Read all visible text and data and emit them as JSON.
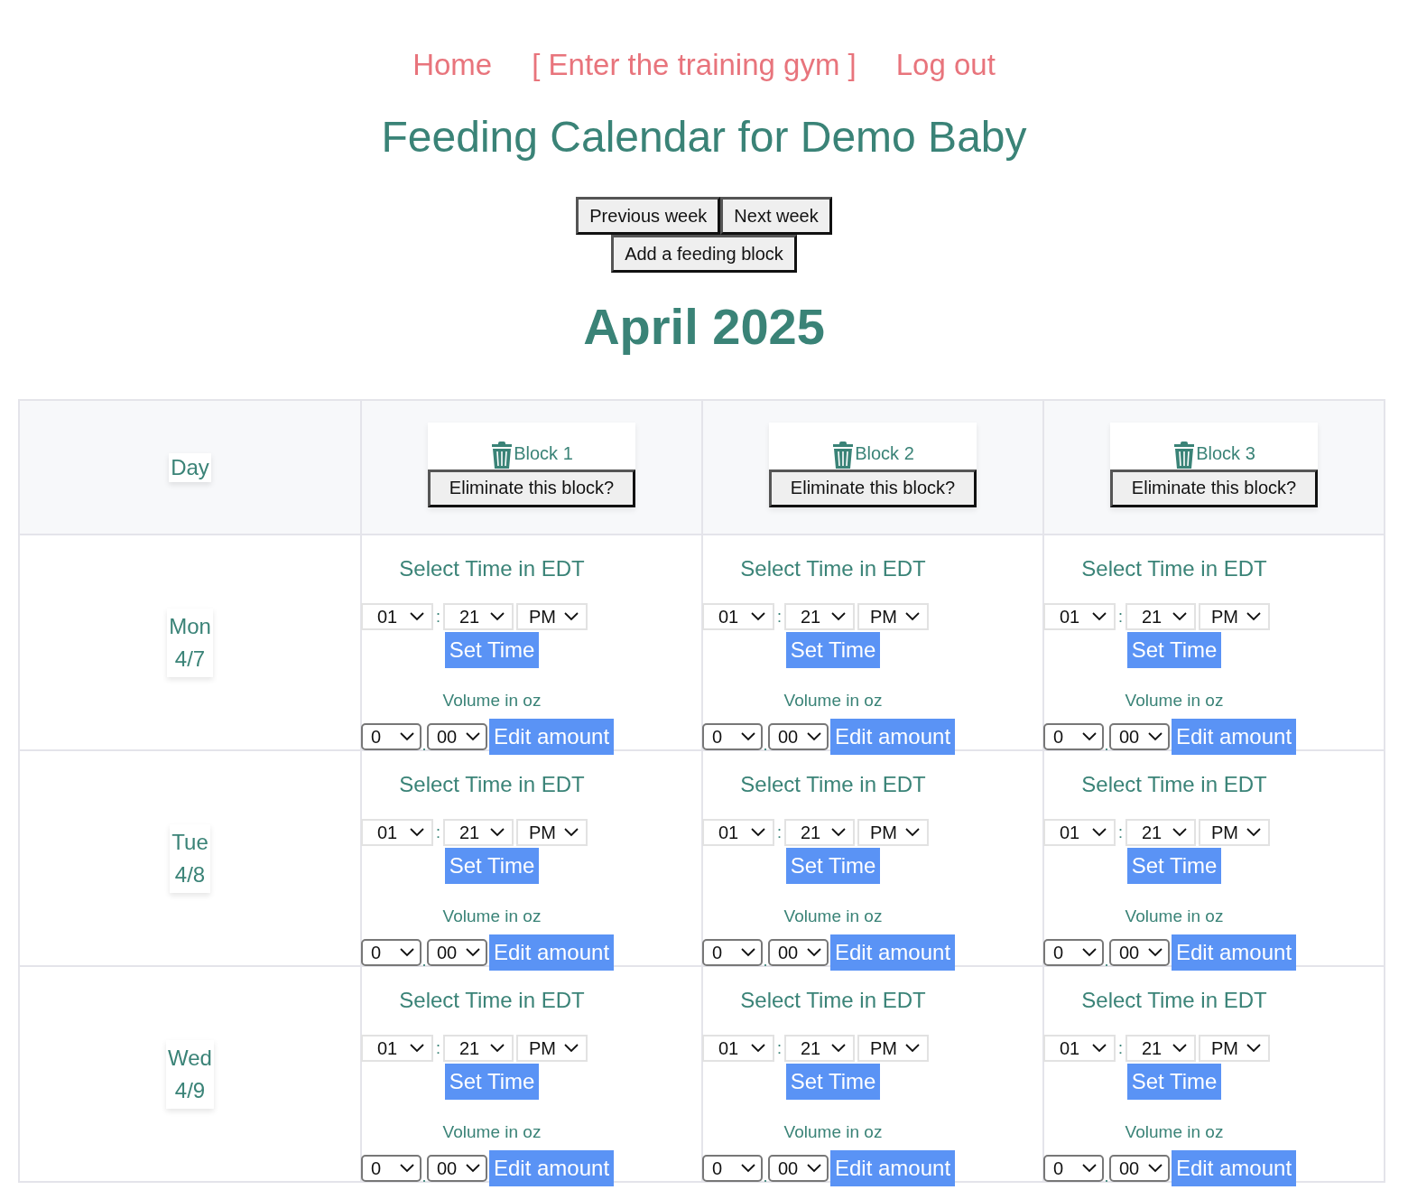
{
  "nav": [
    {
      "label": "Home"
    },
    {
      "label": "[ Enter the training gym ]"
    },
    {
      "label": "Log out"
    }
  ],
  "title": "Feeding Calendar for Demo Baby",
  "week_buttons": [
    "Previous week",
    "Next week"
  ],
  "add_button": "Add a feeding block",
  "month": "April 2025",
  "table": {
    "day_header": "Day",
    "blocks": [
      {
        "label": "Block 1",
        "button": "Eliminate this block?"
      },
      {
        "label": "Block 2",
        "button": "Eliminate this block?"
      },
      {
        "label": "Block 3",
        "button": "Eliminate this block?"
      }
    ],
    "rows": [
      {
        "day": "Mon",
        "date": "4/7",
        "cells": [
          {
            "time_label": "Select Time in EDT",
            "hour": "01",
            "time_separator": ":",
            "minute": "21",
            "meridiem": "PM",
            "set_button": "Set Time",
            "volume_label": "Volume in oz",
            "oz_whole": "0",
            "volume_separator": ".",
            "oz_fraction": "00",
            "edit_button": "Edit amount"
          },
          {
            "time_label": "Select Time in EDT",
            "hour": "01",
            "time_separator": ":",
            "minute": "21",
            "meridiem": "PM",
            "set_button": "Set Time",
            "volume_label": "Volume in oz",
            "oz_whole": "0",
            "volume_separator": ".",
            "oz_fraction": "00",
            "edit_button": "Edit amount"
          },
          {
            "time_label": "Select Time in EDT",
            "hour": "01",
            "time_separator": ":",
            "minute": "21",
            "meridiem": "PM",
            "set_button": "Set Time",
            "volume_label": "Volume in oz",
            "oz_whole": "0",
            "volume_separator": ".",
            "oz_fraction": "00",
            "edit_button": "Edit amount"
          }
        ]
      },
      {
        "day": "Tue",
        "date": "4/8",
        "cells": [
          {
            "time_label": "Select Time in EDT",
            "hour": "01",
            "time_separator": ":",
            "minute": "21",
            "meridiem": "PM",
            "set_button": "Set Time",
            "volume_label": "Volume in oz",
            "oz_whole": "0",
            "volume_separator": ".",
            "oz_fraction": "00",
            "edit_button": "Edit amount"
          },
          {
            "time_label": "Select Time in EDT",
            "hour": "01",
            "time_separator": ":",
            "minute": "21",
            "meridiem": "PM",
            "set_button": "Set Time",
            "volume_label": "Volume in oz",
            "oz_whole": "0",
            "volume_separator": ".",
            "oz_fraction": "00",
            "edit_button": "Edit amount"
          },
          {
            "time_label": "Select Time in EDT",
            "hour": "01",
            "time_separator": ":",
            "minute": "21",
            "meridiem": "PM",
            "set_button": "Set Time",
            "volume_label": "Volume in oz",
            "oz_whole": "0",
            "volume_separator": ".",
            "oz_fraction": "00",
            "edit_button": "Edit amount"
          }
        ]
      },
      {
        "day": "Wed",
        "date": "4/9",
        "cells": [
          {
            "time_label": "Select Time in EDT",
            "hour": "01",
            "time_separator": ":",
            "minute": "21",
            "meridiem": "PM",
            "set_button": "Set Time",
            "volume_label": "Volume in oz",
            "oz_whole": "0",
            "volume_separator": ".",
            "oz_fraction": "00",
            "edit_button": "Edit amount"
          },
          {
            "time_label": "Select Time in EDT",
            "hour": "01",
            "time_separator": ":",
            "minute": "21",
            "meridiem": "PM",
            "set_button": "Set Time",
            "volume_label": "Volume in oz",
            "oz_whole": "0",
            "volume_separator": ".",
            "oz_fraction": "00",
            "edit_button": "Edit amount"
          },
          {
            "time_label": "Select Time in EDT",
            "hour": "01",
            "time_separator": ":",
            "minute": "21",
            "meridiem": "PM",
            "set_button": "Set Time",
            "volume_label": "Volume in oz",
            "oz_whole": "0",
            "volume_separator": ".",
            "oz_fraction": "00",
            "edit_button": "Edit amount"
          }
        ]
      }
    ]
  }
}
